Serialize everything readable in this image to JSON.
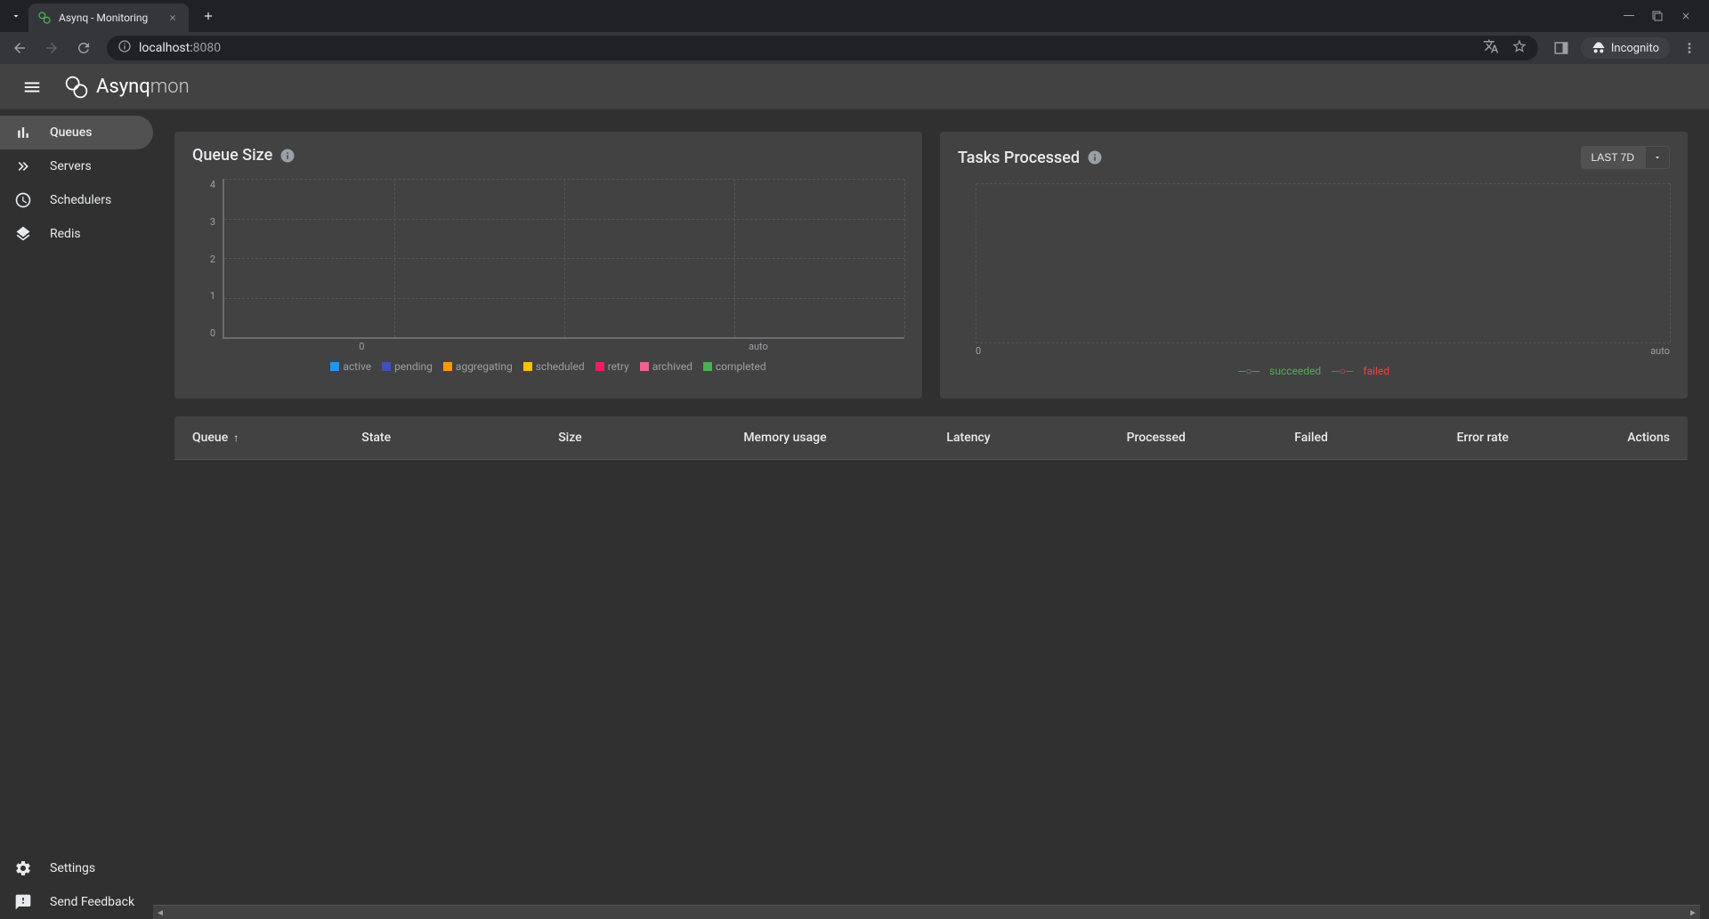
{
  "browser": {
    "tab_title": "Asynq - Monitoring",
    "address_host": "localhost:",
    "address_port": "8080",
    "incognito_label": "Incognito"
  },
  "header": {
    "app_name_bold": "Asynq",
    "app_name_light": "mon"
  },
  "sidebar": {
    "items": [
      {
        "id": "queues",
        "label": "Queues",
        "active": true
      },
      {
        "id": "servers",
        "label": "Servers",
        "active": false
      },
      {
        "id": "schedulers",
        "label": "Schedulers",
        "active": false
      },
      {
        "id": "redis",
        "label": "Redis",
        "active": false
      }
    ],
    "bottom": [
      {
        "id": "settings",
        "label": "Settings"
      },
      {
        "id": "feedback",
        "label": "Send Feedback"
      }
    ]
  },
  "cards": {
    "queue_size": {
      "title": "Queue Size"
    },
    "tasks_processed": {
      "title": "Tasks Processed",
      "time_button": "LAST 7D"
    }
  },
  "chart_data": [
    {
      "type": "bar",
      "title": "Queue Size",
      "ylabel": "",
      "ylim": [
        0,
        4
      ],
      "y_ticks": [
        "4",
        "3",
        "2",
        "1",
        "0"
      ],
      "x_ticks": [
        "0",
        "auto"
      ],
      "categories": [],
      "series": [
        {
          "name": "active",
          "color": "#2196f3",
          "values": []
        },
        {
          "name": "pending",
          "color": "#3f51b5",
          "values": []
        },
        {
          "name": "aggregating",
          "color": "#ff9800",
          "values": []
        },
        {
          "name": "scheduled",
          "color": "#ffc107",
          "values": []
        },
        {
          "name": "retry",
          "color": "#e91e63",
          "values": []
        },
        {
          "name": "archived",
          "color": "#f06292",
          "values": []
        },
        {
          "name": "completed",
          "color": "#4caf50",
          "values": []
        }
      ]
    },
    {
      "type": "line",
      "title": "Tasks Processed",
      "ylabel": "",
      "x_ticks": [
        "0",
        "auto"
      ],
      "series": [
        {
          "name": "succeeded",
          "color": "#4caf50",
          "values": []
        },
        {
          "name": "failed",
          "color": "#f44336",
          "values": []
        }
      ]
    }
  ],
  "table": {
    "columns": [
      {
        "key": "queue",
        "label": "Queue",
        "sortable": true,
        "sort_dir": "asc"
      },
      {
        "key": "state",
        "label": "State"
      },
      {
        "key": "size",
        "label": "Size",
        "align": "right"
      },
      {
        "key": "memory",
        "label": "Memory usage",
        "align": "right"
      },
      {
        "key": "latency",
        "label": "Latency",
        "align": "right"
      },
      {
        "key": "processed",
        "label": "Processed",
        "align": "right"
      },
      {
        "key": "failed",
        "label": "Failed",
        "align": "right"
      },
      {
        "key": "error_rate",
        "label": "Error rate",
        "align": "right"
      },
      {
        "key": "actions",
        "label": "Actions",
        "align": "right"
      }
    ],
    "rows": []
  }
}
